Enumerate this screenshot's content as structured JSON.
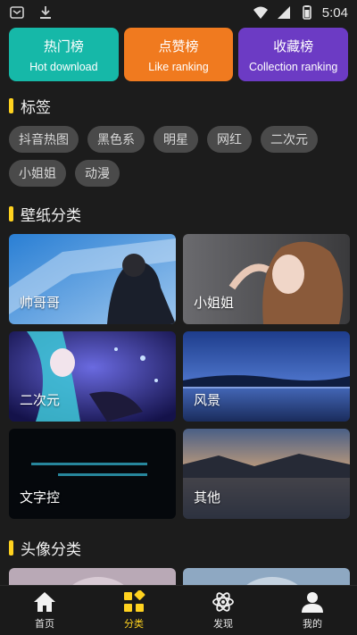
{
  "status_bar": {
    "time": "5:04"
  },
  "ranking": [
    {
      "title": "热门榜",
      "subtitle": "Hot download",
      "color": "#16b8a8"
    },
    {
      "title": "点赞榜",
      "subtitle": "Like ranking",
      "color": "#f07a1f"
    },
    {
      "title": "收藏榜",
      "subtitle": "Collection ranking",
      "color": "#6c3bc4"
    }
  ],
  "tags_section": {
    "title": "标签",
    "tags": [
      "抖音热图",
      "黑色系",
      "明星",
      "网红",
      "二次元",
      "小姐姐",
      "动漫"
    ]
  },
  "wallpaper_section": {
    "title": "壁纸分类",
    "categories": [
      "帅哥哥",
      "小姐姐",
      "二次元",
      "风景",
      "文字控",
      "其他"
    ]
  },
  "avatar_section": {
    "title": "头像分类"
  },
  "bottom_nav": {
    "items": [
      {
        "label": "首页",
        "icon": "home-icon"
      },
      {
        "label": "分类",
        "icon": "category-icon"
      },
      {
        "label": "发现",
        "icon": "atom-icon"
      },
      {
        "label": "我的",
        "icon": "person-icon"
      }
    ],
    "active_index": 1,
    "accent_color": "#ffd21f"
  }
}
